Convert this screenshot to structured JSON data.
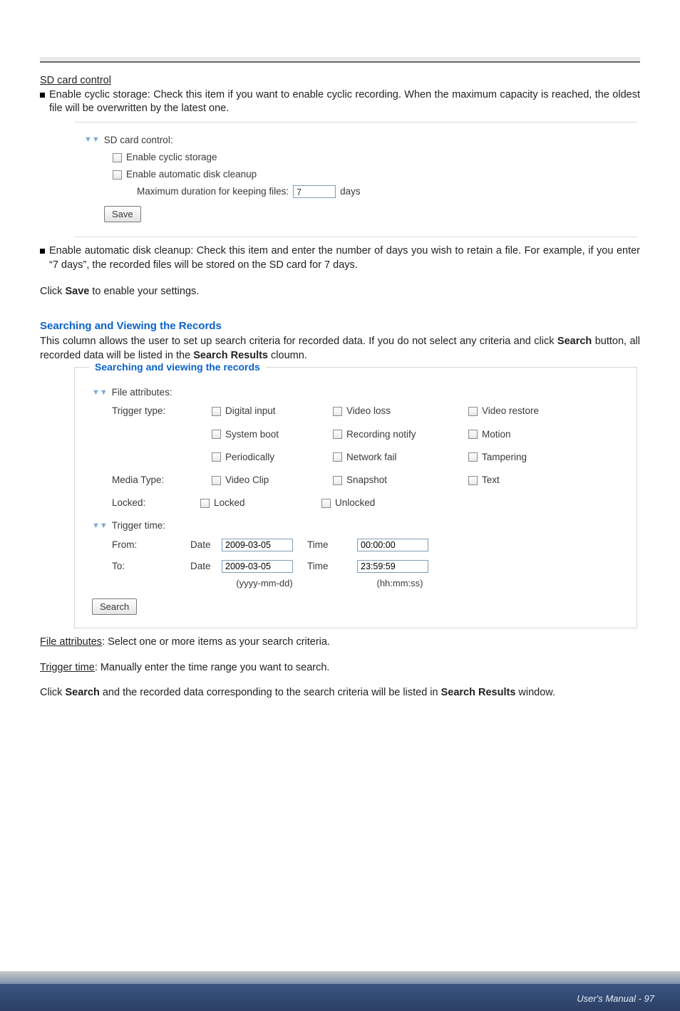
{
  "sd_card": {
    "heading": "SD card control",
    "bullet1": "Enable cyclic storage: Check this item if you want to enable cyclic recording. When the maximum capacity is reached, the oldest file will be overwritten by the latest one.",
    "panel": {
      "title": "SD card control:",
      "opt_cyclic": "Enable cyclic storage",
      "opt_cleanup": "Enable automatic disk cleanup",
      "max_label": "Maximum duration for keeping files:",
      "max_value": "7",
      "days": "days",
      "save": "Save"
    },
    "bullet2": "Enable automatic disk cleanup: Check this item and enter the number of days you wish to retain a file. For example, if you enter “7 days”, the recorded files will be stored on the SD card for 7 days.",
    "click_save_prefix": "Click ",
    "click_save_bold": "Save",
    "click_save_suffix": " to enable your settings."
  },
  "search": {
    "heading": "Searching and Viewing the Records",
    "intro_a": "This column allows the user to set up search criteria for recorded data. If you do not select any criteria and click ",
    "intro_b": "Search",
    "intro_c": " button, all recorded data will be listed in the ",
    "intro_d": "Search Results",
    "intro_e": " cloumn.",
    "legend": "Searching and viewing the records",
    "fa_title": "File attributes:",
    "labels": {
      "trigger_type": "Trigger type:",
      "media_type": "Media Type:",
      "locked": "Locked:"
    },
    "opts": {
      "digital_input": "Digital input",
      "video_loss": "Video loss",
      "video_restore": "Video restore",
      "system_boot": "System boot",
      "recording_notify": "Recording notify",
      "motion": "Motion",
      "periodically": "Periodically",
      "network_fail": "Network fail",
      "tampering": "Tampering",
      "video_clip": "Video Clip",
      "snapshot": "Snapshot",
      "text": "Text",
      "locked": "Locked",
      "unlocked": "Unlocked"
    },
    "tt_title": "Trigger time:",
    "from": "From:",
    "to": "To:",
    "date": "Date",
    "time": "Time",
    "from_date": "2009-03-05",
    "from_time": "00:00:00",
    "to_date": "2009-03-05",
    "to_time": "23:59:59",
    "fmt_date": "(yyyy-mm-dd)",
    "fmt_time": "(hh:mm:ss)",
    "search_btn": "Search",
    "fa_desc_a": "File attributes",
    "fa_desc_b": ": Select one or more items as your search criteria.",
    "tt_desc_a": "Trigger time",
    "tt_desc_b": ": Manually enter the time range you want to search.",
    "final_a": "Click ",
    "final_b": "Search",
    "final_c": " and the recorded data corresponding to the search criteria will be listed in ",
    "final_d": "Search Results",
    "final_e": " window."
  },
  "footer": "User's Manual - 97"
}
